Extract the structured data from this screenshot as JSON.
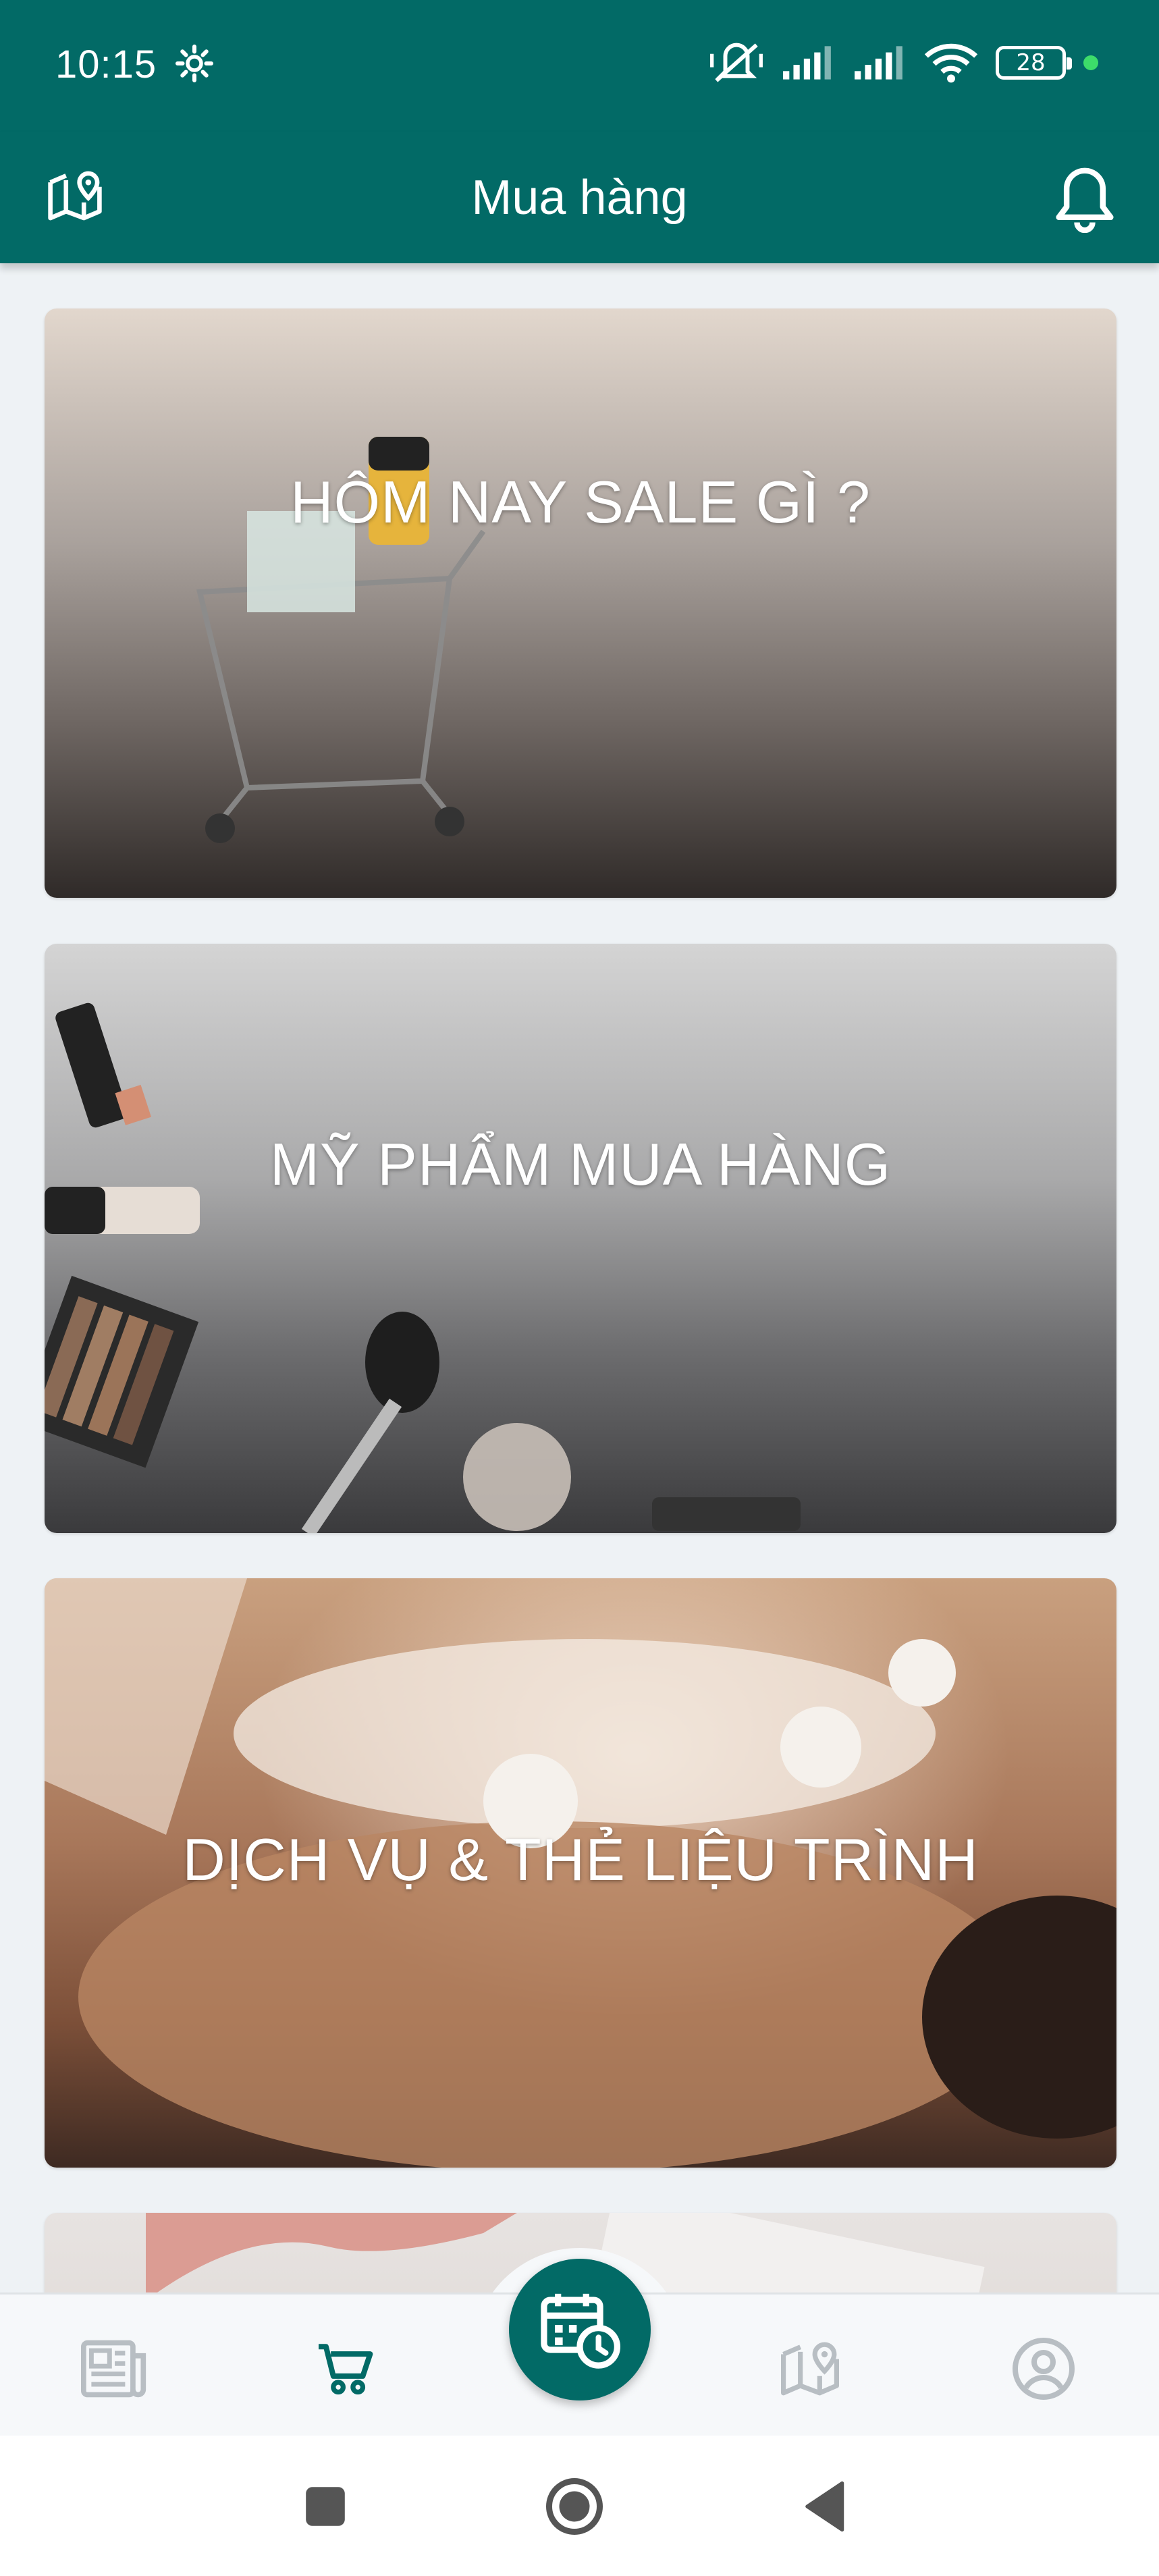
{
  "status_bar": {
    "time": "10:15",
    "battery_level": "28"
  },
  "app_bar": {
    "title": "Mua hàng"
  },
  "cards": [
    {
      "title": "HÔM NAY SALE GÌ ?"
    },
    {
      "title": "MỸ PHẨM MUA HÀNG"
    },
    {
      "title": "DỊCH VỤ & THẺ LIỆU TRÌNH"
    },
    {
      "title": ""
    }
  ],
  "bottom_nav": {
    "items": [
      {
        "icon": "news-icon",
        "active": false
      },
      {
        "icon": "cart-icon",
        "active": true
      },
      {
        "icon": "calendar-clock-icon",
        "active": false
      },
      {
        "icon": "map-pin-icon",
        "active": false
      },
      {
        "icon": "profile-icon",
        "active": false
      }
    ]
  },
  "colors": {
    "primary": "#026a66",
    "inactive_icon": "#b8bec3",
    "page_bg": "#eef2f5"
  }
}
